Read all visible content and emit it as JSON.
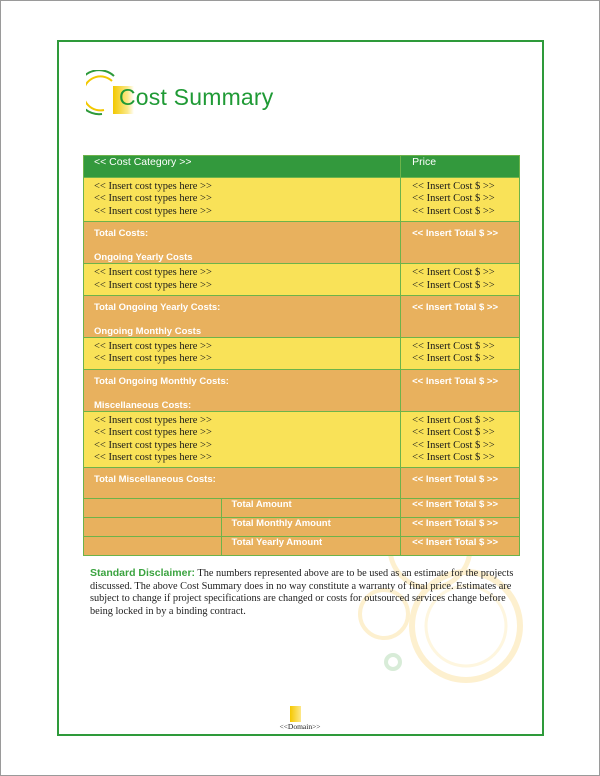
{
  "document": {
    "title": "Cost Summary",
    "footer_domain": "<<Domain>>",
    "colors": {
      "brand_green": "#2e9a3a",
      "header_green": "#33993d",
      "item_yellow": "#f9e258",
      "total_orange": "#e8b15e",
      "accent_yellow": "#f2c800"
    }
  },
  "table": {
    "header": {
      "category": "<< Cost Category >>",
      "price": "Price"
    },
    "sections": [
      {
        "items": [
          {
            "type": "<< Insert cost types here >>",
            "cost": "<< Insert Cost $ >>"
          },
          {
            "type": "<< Insert cost types here >>",
            "cost": "<< Insert Cost $ >>"
          },
          {
            "type": "<< Insert cost types here >>",
            "cost": "<< Insert Cost $ >>"
          }
        ],
        "total_label": "Total Costs:",
        "total_value": "<< Insert Total $ >>",
        "next_heading": "Ongoing Yearly Costs"
      },
      {
        "items": [
          {
            "type": "<< Insert cost types here >>",
            "cost": "<< Insert Cost $ >>"
          },
          {
            "type": "<< Insert cost types here >>",
            "cost": "<< Insert Cost $ >>"
          }
        ],
        "total_label": "Total Ongoing Yearly Costs:",
        "total_value": "<< Insert Total $ >>",
        "next_heading": "Ongoing Monthly Costs"
      },
      {
        "items": [
          {
            "type": "<< Insert cost types here >>",
            "cost": "<< Insert Cost $ >>"
          },
          {
            "type": "<< Insert cost types here >>",
            "cost": "<< Insert Cost $ >>"
          }
        ],
        "total_label": "Total Ongoing Monthly Costs:",
        "total_value": "<< Insert Total $ >>",
        "next_heading": "Miscellaneous Costs:"
      },
      {
        "items": [
          {
            "type": "<< Insert cost types here >>",
            "cost": "<< Insert Cost $ >>"
          },
          {
            "type": "<< Insert cost types here >>",
            "cost": "<< Insert Cost $ >>"
          },
          {
            "type": "<< Insert cost types here >>",
            "cost": "<< Insert Cost $ >>"
          },
          {
            "type": "<< Insert cost types here >>",
            "cost": "<< Insert Cost $ >>"
          }
        ],
        "total_label": "Total Miscellaneous Costs:",
        "total_value": "<< Insert Total $ >>",
        "next_heading": ""
      }
    ],
    "summary": [
      {
        "label": "Total Amount",
        "value": "<< Insert Total $ >>"
      },
      {
        "label": "Total Monthly Amount",
        "value": "<< Insert Total $ >>"
      },
      {
        "label": "Total Yearly Amount",
        "value": "<< Insert Total $ >>"
      }
    ]
  },
  "disclaimer": {
    "lead": "Standard Disclaimer:",
    "text": " The numbers represented above are to be used as an estimate for the projects discussed. The above Cost Summary does in no way constitute a warranty of final price. Estimates are subject to change if project specifications are changed or costs for outsourced services change before being locked in by a binding contract."
  },
  "icons": {
    "logo": "circle-swoosh-logo-icon",
    "decoration": "concentric-circles-decoration"
  }
}
